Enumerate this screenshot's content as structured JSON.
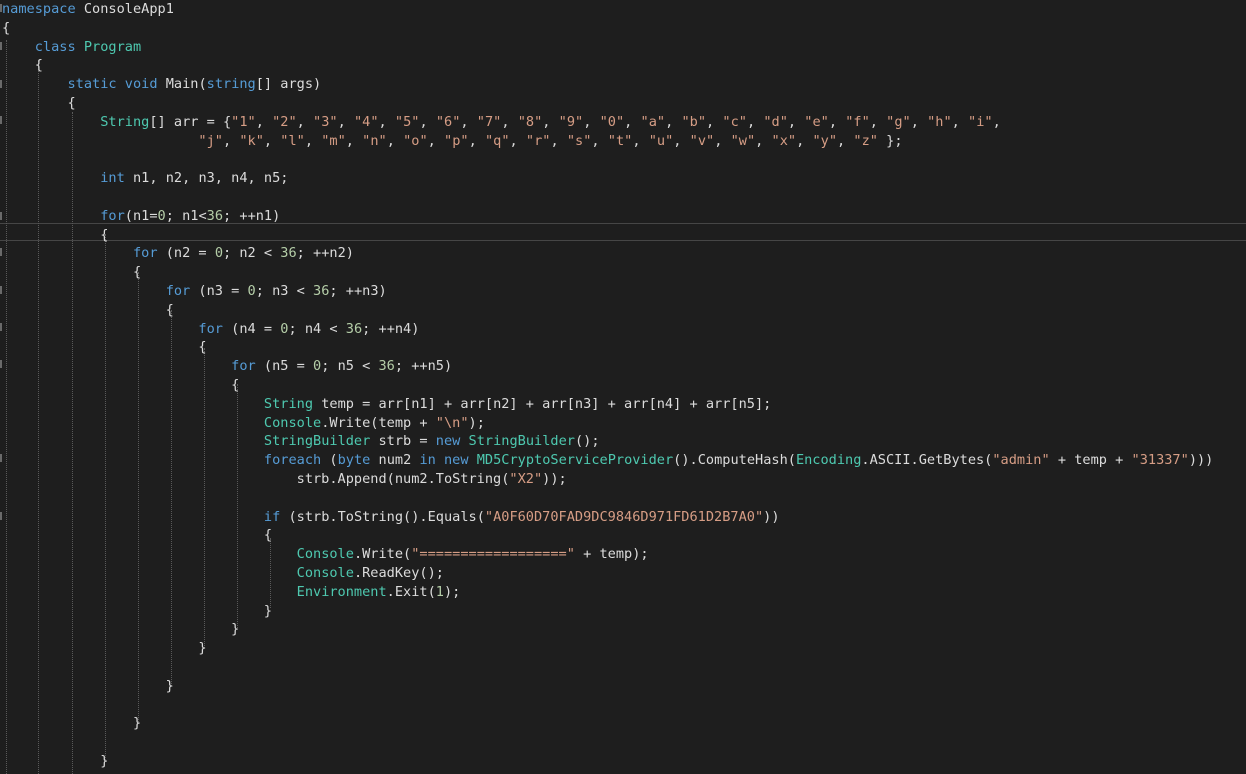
{
  "code": {
    "lines": [
      [
        {
          "t": "namespace",
          "c": "kw"
        },
        {
          "t": " ConsoleApp1",
          "c": "pl"
        }
      ],
      [
        {
          "t": "{",
          "c": "pl"
        }
      ],
      [
        {
          "t": "    ",
          "c": "pl"
        },
        {
          "t": "class",
          "c": "kw"
        },
        {
          "t": " ",
          "c": "pl"
        },
        {
          "t": "Program",
          "c": "typ"
        }
      ],
      [
        {
          "t": "    {",
          "c": "pl"
        }
      ],
      [
        {
          "t": "        ",
          "c": "pl"
        },
        {
          "t": "static",
          "c": "kw"
        },
        {
          "t": " ",
          "c": "pl"
        },
        {
          "t": "void",
          "c": "kw"
        },
        {
          "t": " Main(",
          "c": "pl"
        },
        {
          "t": "string",
          "c": "kw"
        },
        {
          "t": "[] args)",
          "c": "pl"
        }
      ],
      [
        {
          "t": "        {",
          "c": "pl"
        }
      ],
      [
        {
          "t": "            ",
          "c": "pl"
        },
        {
          "t": "String",
          "c": "typ"
        },
        {
          "t": "[] arr = {",
          "c": "pl"
        },
        {
          "t": "\"1\"",
          "c": "str"
        },
        {
          "t": ", ",
          "c": "pl"
        },
        {
          "t": "\"2\"",
          "c": "str"
        },
        {
          "t": ", ",
          "c": "pl"
        },
        {
          "t": "\"3\"",
          "c": "str"
        },
        {
          "t": ", ",
          "c": "pl"
        },
        {
          "t": "\"4\"",
          "c": "str"
        },
        {
          "t": ", ",
          "c": "pl"
        },
        {
          "t": "\"5\"",
          "c": "str"
        },
        {
          "t": ", ",
          "c": "pl"
        },
        {
          "t": "\"6\"",
          "c": "str"
        },
        {
          "t": ", ",
          "c": "pl"
        },
        {
          "t": "\"7\"",
          "c": "str"
        },
        {
          "t": ", ",
          "c": "pl"
        },
        {
          "t": "\"8\"",
          "c": "str"
        },
        {
          "t": ", ",
          "c": "pl"
        },
        {
          "t": "\"9\"",
          "c": "str"
        },
        {
          "t": ", ",
          "c": "pl"
        },
        {
          "t": "\"0\"",
          "c": "str"
        },
        {
          "t": ", ",
          "c": "pl"
        },
        {
          "t": "\"a\"",
          "c": "str"
        },
        {
          "t": ", ",
          "c": "pl"
        },
        {
          "t": "\"b\"",
          "c": "str"
        },
        {
          "t": ", ",
          "c": "pl"
        },
        {
          "t": "\"c\"",
          "c": "str"
        },
        {
          "t": ", ",
          "c": "pl"
        },
        {
          "t": "\"d\"",
          "c": "str"
        },
        {
          "t": ", ",
          "c": "pl"
        },
        {
          "t": "\"e\"",
          "c": "str"
        },
        {
          "t": ", ",
          "c": "pl"
        },
        {
          "t": "\"f\"",
          "c": "str"
        },
        {
          "t": ", ",
          "c": "pl"
        },
        {
          "t": "\"g\"",
          "c": "str"
        },
        {
          "t": ", ",
          "c": "pl"
        },
        {
          "t": "\"h\"",
          "c": "str"
        },
        {
          "t": ", ",
          "c": "pl"
        },
        {
          "t": "\"i\"",
          "c": "str"
        },
        {
          "t": ",",
          "c": "pl"
        }
      ],
      [
        {
          "t": "                        ",
          "c": "pl"
        },
        {
          "t": "\"j\"",
          "c": "str"
        },
        {
          "t": ", ",
          "c": "pl"
        },
        {
          "t": "\"k\"",
          "c": "str"
        },
        {
          "t": ", ",
          "c": "pl"
        },
        {
          "t": "\"l\"",
          "c": "str"
        },
        {
          "t": ", ",
          "c": "pl"
        },
        {
          "t": "\"m\"",
          "c": "str"
        },
        {
          "t": ", ",
          "c": "pl"
        },
        {
          "t": "\"n\"",
          "c": "str"
        },
        {
          "t": ", ",
          "c": "pl"
        },
        {
          "t": "\"o\"",
          "c": "str"
        },
        {
          "t": ", ",
          "c": "pl"
        },
        {
          "t": "\"p\"",
          "c": "str"
        },
        {
          "t": ", ",
          "c": "pl"
        },
        {
          "t": "\"q\"",
          "c": "str"
        },
        {
          "t": ", ",
          "c": "pl"
        },
        {
          "t": "\"r\"",
          "c": "str"
        },
        {
          "t": ", ",
          "c": "pl"
        },
        {
          "t": "\"s\"",
          "c": "str"
        },
        {
          "t": ", ",
          "c": "pl"
        },
        {
          "t": "\"t\"",
          "c": "str"
        },
        {
          "t": ", ",
          "c": "pl"
        },
        {
          "t": "\"u\"",
          "c": "str"
        },
        {
          "t": ", ",
          "c": "pl"
        },
        {
          "t": "\"v\"",
          "c": "str"
        },
        {
          "t": ", ",
          "c": "pl"
        },
        {
          "t": "\"w\"",
          "c": "str"
        },
        {
          "t": ", ",
          "c": "pl"
        },
        {
          "t": "\"x\"",
          "c": "str"
        },
        {
          "t": ", ",
          "c": "pl"
        },
        {
          "t": "\"y\"",
          "c": "str"
        },
        {
          "t": ", ",
          "c": "pl"
        },
        {
          "t": "\"z\"",
          "c": "str"
        },
        {
          "t": " };",
          "c": "pl"
        }
      ],
      [],
      [
        {
          "t": "            ",
          "c": "pl"
        },
        {
          "t": "int",
          "c": "kw"
        },
        {
          "t": " n1, n2, n3, n4, n5;",
          "c": "pl"
        }
      ],
      [],
      [
        {
          "t": "            ",
          "c": "pl"
        },
        {
          "t": "for",
          "c": "kw"
        },
        {
          "t": "(n1=",
          "c": "pl"
        },
        {
          "t": "0",
          "c": "num"
        },
        {
          "t": "; n1<",
          "c": "pl"
        },
        {
          "t": "36",
          "c": "num"
        },
        {
          "t": "; ++n1)",
          "c": "pl"
        }
      ],
      [
        {
          "t": "            {",
          "c": "pl"
        }
      ],
      [
        {
          "t": "                ",
          "c": "pl"
        },
        {
          "t": "for",
          "c": "kw"
        },
        {
          "t": " (n2 = ",
          "c": "pl"
        },
        {
          "t": "0",
          "c": "num"
        },
        {
          "t": "; n2 < ",
          "c": "pl"
        },
        {
          "t": "36",
          "c": "num"
        },
        {
          "t": "; ++n2)",
          "c": "pl"
        }
      ],
      [
        {
          "t": "                {",
          "c": "pl"
        }
      ],
      [
        {
          "t": "                    ",
          "c": "pl"
        },
        {
          "t": "for",
          "c": "kw"
        },
        {
          "t": " (n3 = ",
          "c": "pl"
        },
        {
          "t": "0",
          "c": "num"
        },
        {
          "t": "; n3 < ",
          "c": "pl"
        },
        {
          "t": "36",
          "c": "num"
        },
        {
          "t": "; ++n3)",
          "c": "pl"
        }
      ],
      [
        {
          "t": "                    {",
          "c": "pl"
        }
      ],
      [
        {
          "t": "                        ",
          "c": "pl"
        },
        {
          "t": "for",
          "c": "kw"
        },
        {
          "t": " (n4 = ",
          "c": "pl"
        },
        {
          "t": "0",
          "c": "num"
        },
        {
          "t": "; n4 < ",
          "c": "pl"
        },
        {
          "t": "36",
          "c": "num"
        },
        {
          "t": "; ++n4)",
          "c": "pl"
        }
      ],
      [
        {
          "t": "                        {",
          "c": "pl"
        }
      ],
      [
        {
          "t": "                            ",
          "c": "pl"
        },
        {
          "t": "for",
          "c": "kw"
        },
        {
          "t": " (n5 = ",
          "c": "pl"
        },
        {
          "t": "0",
          "c": "num"
        },
        {
          "t": "; n5 < ",
          "c": "pl"
        },
        {
          "t": "36",
          "c": "num"
        },
        {
          "t": "; ++n5)",
          "c": "pl"
        }
      ],
      [
        {
          "t": "                            {",
          "c": "pl"
        }
      ],
      [
        {
          "t": "                                ",
          "c": "pl"
        },
        {
          "t": "String",
          "c": "typ"
        },
        {
          "t": " temp = arr[n1] + arr[n2] + arr[n3] + arr[n4] + arr[n5];",
          "c": "pl"
        }
      ],
      [
        {
          "t": "                                ",
          "c": "pl"
        },
        {
          "t": "Console",
          "c": "typ"
        },
        {
          "t": ".Write(temp + ",
          "c": "pl"
        },
        {
          "t": "\"\\n\"",
          "c": "str"
        },
        {
          "t": ");",
          "c": "pl"
        }
      ],
      [
        {
          "t": "                                ",
          "c": "pl"
        },
        {
          "t": "StringBuilder",
          "c": "typ"
        },
        {
          "t": " strb = ",
          "c": "pl"
        },
        {
          "t": "new",
          "c": "kw"
        },
        {
          "t": " ",
          "c": "pl"
        },
        {
          "t": "StringBuilder",
          "c": "typ"
        },
        {
          "t": "();",
          "c": "pl"
        }
      ],
      [
        {
          "t": "                                ",
          "c": "pl"
        },
        {
          "t": "foreach",
          "c": "kw"
        },
        {
          "t": " (",
          "c": "pl"
        },
        {
          "t": "byte",
          "c": "kw"
        },
        {
          "t": " num2 ",
          "c": "pl"
        },
        {
          "t": "in",
          "c": "kw"
        },
        {
          "t": " ",
          "c": "pl"
        },
        {
          "t": "new",
          "c": "kw"
        },
        {
          "t": " ",
          "c": "pl"
        },
        {
          "t": "MD5CryptoServiceProvider",
          "c": "typ"
        },
        {
          "t": "().ComputeHash(",
          "c": "pl"
        },
        {
          "t": "Encoding",
          "c": "typ"
        },
        {
          "t": ".ASCII.GetBytes(",
          "c": "pl"
        },
        {
          "t": "\"admin\"",
          "c": "str"
        },
        {
          "t": " + temp + ",
          "c": "pl"
        },
        {
          "t": "\"31337\"",
          "c": "str"
        },
        {
          "t": ")))",
          "c": "pl"
        }
      ],
      [
        {
          "t": "                                    strb.Append(num2.ToString(",
          "c": "pl"
        },
        {
          "t": "\"X2\"",
          "c": "str"
        },
        {
          "t": "));",
          "c": "pl"
        }
      ],
      [],
      [
        {
          "t": "                                ",
          "c": "pl"
        },
        {
          "t": "if",
          "c": "kw"
        },
        {
          "t": " (strb.ToString().Equals(",
          "c": "pl"
        },
        {
          "t": "\"A0F60D70FAD9DC9846D971FD61D2B7A0\"",
          "c": "str"
        },
        {
          "t": "))",
          "c": "pl"
        }
      ],
      [
        {
          "t": "                                {",
          "c": "pl"
        }
      ],
      [
        {
          "t": "                                    ",
          "c": "pl"
        },
        {
          "t": "Console",
          "c": "typ"
        },
        {
          "t": ".Write(",
          "c": "pl"
        },
        {
          "t": "\"==================\"",
          "c": "str"
        },
        {
          "t": " + temp);",
          "c": "pl"
        }
      ],
      [
        {
          "t": "                                    ",
          "c": "pl"
        },
        {
          "t": "Console",
          "c": "typ"
        },
        {
          "t": ".ReadKey();",
          "c": "pl"
        }
      ],
      [
        {
          "t": "                                    ",
          "c": "pl"
        },
        {
          "t": "Environment",
          "c": "typ"
        },
        {
          "t": ".Exit(",
          "c": "pl"
        },
        {
          "t": "1",
          "c": "num"
        },
        {
          "t": ");",
          "c": "pl"
        }
      ],
      [
        {
          "t": "                                }",
          "c": "pl"
        }
      ],
      [
        {
          "t": "                            }",
          "c": "pl"
        }
      ],
      [
        {
          "t": "                        }",
          "c": "pl"
        }
      ],
      [],
      [
        {
          "t": "                    }",
          "c": "pl"
        }
      ],
      [],
      [
        {
          "t": "                }",
          "c": "pl"
        }
      ],
      [],
      [
        {
          "t": "            }",
          "c": "pl"
        }
      ]
    ]
  },
  "colors": {
    "background": "#1e1e1e",
    "keyword": "#569cd6",
    "type": "#4ec9b0",
    "string": "#d69d85",
    "number": "#b5cea8",
    "plain": "#dcdcdc"
  }
}
